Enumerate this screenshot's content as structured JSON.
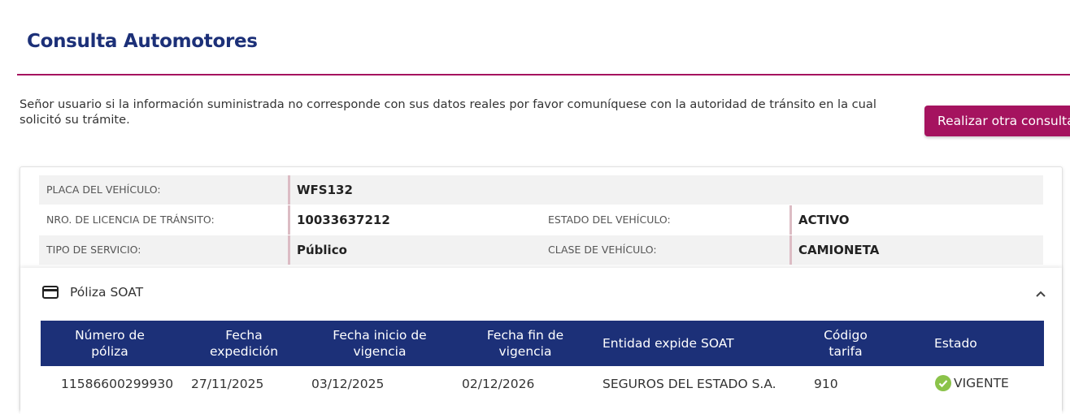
{
  "page": {
    "title": "Consulta Automotores",
    "notice": "Señor usuario si la información suministrada no corresponde con sus datos reales por favor comuníquese con la autoridad de tránsito en la cual solicitó su trámite.",
    "other_query_button": "Realizar otra consulta"
  },
  "vehicle": {
    "plate_label": "PLACA DEL VEHÍCULO:",
    "plate_value": "WFS132",
    "license_label": "NRO. DE LICENCIA DE TRÁNSITO:",
    "license_value": "10033637212",
    "state_label": "ESTADO DEL VEHÍCULO:",
    "state_value": "ACTIVO",
    "service_label": "TIPO DE SERVICIO:",
    "service_value": "Público",
    "class_label": "CLASE DE VEHÍCULO:",
    "class_value": "CAMIONETA"
  },
  "soat": {
    "title": "Póliza SOAT",
    "icon": "credit-card-icon",
    "collapse_icon": "chevron-up-icon",
    "headers": [
      "Número de póliza",
      "Fecha expedición",
      "Fecha inicio de vigencia",
      "Fecha fin de vigencia",
      "Entidad expide SOAT",
      "Código tarifa",
      "Estado"
    ],
    "rows": [
      {
        "policy_number": "11586600299930",
        "issue_date": "27/11/2025",
        "start_date": "03/12/2025",
        "end_date": "02/12/2026",
        "entity": "SEGUROS DEL ESTADO S.A.",
        "rate_code": "910",
        "status": "VIGENTE",
        "status_icon": "check-circle-icon"
      }
    ]
  },
  "colors": {
    "brand_blue": "#1c3078",
    "accent_magenta": "#a5135f",
    "status_green": "#8bc34a"
  }
}
